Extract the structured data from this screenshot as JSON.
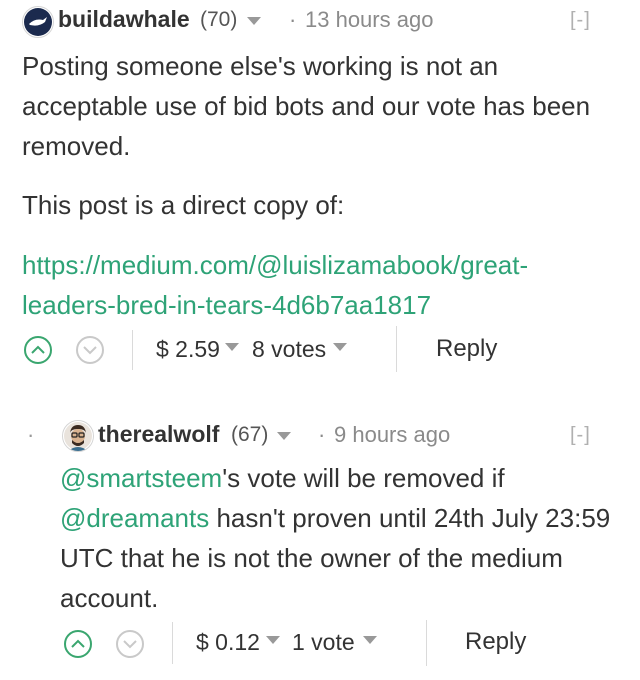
{
  "comment": {
    "author": "buildawhale",
    "reputation": "(70)",
    "separator": "·",
    "time": "13 hours ago",
    "collapse_label": "[-]",
    "body_line1": "Posting someone else's working is not an",
    "body_line2": "acceptable use of bid bots and our vote has been",
    "body_line3": "removed.",
    "body_line4": "This post is a direct copy of:",
    "link_line1": "https://medium.com/@luislizamabook/great-",
    "link_line2": "leaders-bred-in-tears-4d6b7aa1817",
    "payout": "$ 2.59",
    "votes": "8 votes",
    "reply_label": "Reply"
  },
  "reply_comment": {
    "bullet": "·",
    "author": "therealwolf",
    "reputation": "(67)",
    "separator": "·",
    "time": "9 hours ago",
    "collapse_label": "[-]",
    "mention1": "@smartsteem",
    "text_after_mention1": "'s vote will be removed if",
    "mention2": "@dreamants",
    "text_after_mention2": " hasn't proven until 24th July 23:59",
    "body_line3": "UTC that he is not the owner of the medium",
    "body_line4": "account.",
    "payout": "$ 0.12",
    "votes": "1 vote",
    "reply_label": "Reply"
  },
  "colors": {
    "link": "#2ea377",
    "upvote": "#3aa66f",
    "text": "#333333",
    "muted": "#8a8a8a"
  }
}
